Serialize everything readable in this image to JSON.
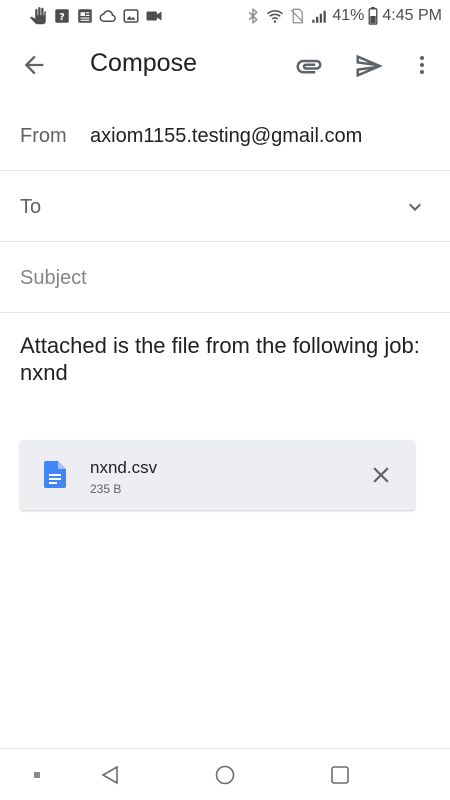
{
  "status_bar": {
    "left_icons": [
      "hand-icon",
      "help-box-icon",
      "news-icon",
      "cloud-icon",
      "image-icon",
      "video-camera-icon"
    ],
    "right_icons": [
      "bluetooth-icon",
      "wifi-icon",
      "no-sim-icon",
      "signal-icon"
    ],
    "battery_percent": "41%",
    "time": "4:45 PM"
  },
  "app_bar": {
    "title": "Compose",
    "icons": [
      "back-arrow-icon",
      "paperclip-icon",
      "send-icon",
      "more-vert-icon"
    ]
  },
  "compose": {
    "from_label": "From",
    "from_value": "axiom1155.testing@gmail.com",
    "to_label": "To",
    "subject_placeholder": "Subject",
    "body": "Attached is the file from the following job: nxnd"
  },
  "attachment": {
    "file_name": "nxnd.csv",
    "file_size": "235 B",
    "icon": "document-icon",
    "icon_color": "#4285f4"
  },
  "colors": {
    "accent_blue": "#4285f4",
    "chip_bg": "#eceef1",
    "text_primary": "#202124",
    "text_secondary": "#5f6368"
  }
}
